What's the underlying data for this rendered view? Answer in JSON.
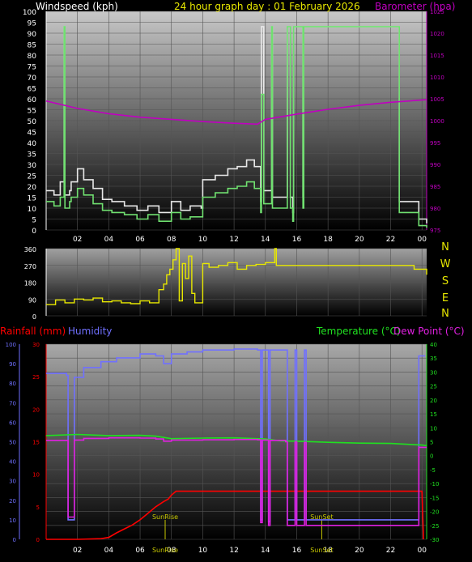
{
  "header": {
    "title": "24 hour graph day : 01 February 2026",
    "left_label": "Windspeed (kph)",
    "right_label": "Barometer (hpa)"
  },
  "colors": {
    "wind_gust": "#e8e8e8",
    "wind_avg": "#70e070",
    "wind_dir": "#e8e800",
    "barometer": "#c000c0",
    "rainfall": "#ff0000",
    "humidity": "#7070ff",
    "temperature": "#20e020",
    "dewpoint": "#e020e0",
    "sun": "#c8c800",
    "axis_text": "#ffffff",
    "title_yellow": "#e8e800"
  },
  "chart_data": [
    {
      "type": "line",
      "title": "24 hour graph day : 01 February 2026",
      "ylabel": "Windspeed (kph)",
      "y2label": "Barometer (hpa)",
      "xlim": [
        0,
        24.3
      ],
      "x_ticks": [
        "02",
        "04",
        "06",
        "08",
        "10",
        "12",
        "14",
        "16",
        "18",
        "20",
        "22",
        "00"
      ],
      "ylim": [
        0,
        100
      ],
      "y_ticks": [
        0,
        5,
        10,
        15,
        20,
        25,
        30,
        35,
        40,
        45,
        50,
        55,
        60,
        65,
        70,
        75,
        80,
        85,
        90,
        95,
        100
      ],
      "y2lim": [
        975,
        1025
      ],
      "y2_ticks": [
        975,
        980,
        985,
        990,
        995,
        1000,
        1005,
        1010,
        1015,
        1020,
        1025
      ],
      "grid": true,
      "series": [
        {
          "name": "Gust",
          "axis": "left",
          "color": "wind_gust",
          "step": true,
          "x": [
            0,
            0.5,
            0.9,
            1.15,
            1.2,
            1.5,
            1.6,
            2.0,
            2.4,
            3.0,
            3.6,
            4.2,
            5.0,
            5.8,
            6.5,
            7.2,
            8.0,
            8.6,
            9.2,
            9.9,
            10.0,
            10.8,
            11.6,
            12.2,
            12.8,
            13.3,
            13.7,
            13.75,
            13.9,
            14.4,
            14.45,
            15.4,
            15.6,
            15.75,
            15.8,
            16.4,
            16.45,
            22.5,
            22.55,
            23.8,
            24.3
          ],
          "y": [
            18,
            16,
            22,
            93,
            16,
            18,
            22,
            28,
            23,
            19,
            14,
            13,
            11,
            9,
            11,
            8,
            13,
            9,
            11,
            10,
            23,
            25,
            28,
            29,
            32,
            29,
            13,
            93,
            18,
            93,
            15,
            93,
            15,
            8,
            93,
            15,
            93,
            93,
            13,
            5,
            3
          ]
        },
        {
          "name": "Average",
          "axis": "left",
          "color": "wind_avg",
          "step": true,
          "x": [
            0,
            0.5,
            0.9,
            1.15,
            1.2,
            1.5,
            1.6,
            2.0,
            2.4,
            3.0,
            3.6,
            4.2,
            5.0,
            5.8,
            6.5,
            7.2,
            8.0,
            8.6,
            9.2,
            9.9,
            10.0,
            10.8,
            11.6,
            12.2,
            12.8,
            13.3,
            13.7,
            13.75,
            13.9,
            14.4,
            14.45,
            15.4,
            15.6,
            15.75,
            15.8,
            16.4,
            16.45,
            22.5,
            22.55,
            23.8,
            24.3
          ],
          "y": [
            13,
            11,
            15,
            93,
            10,
            13,
            15,
            19,
            16,
            12,
            9,
            8,
            7,
            5,
            7,
            4,
            8,
            5,
            6,
            6,
            15,
            17,
            19,
            20,
            22,
            19,
            8,
            62,
            12,
            93,
            10,
            93,
            10,
            4,
            93,
            10,
            93,
            93,
            8,
            2,
            1
          ]
        },
        {
          "name": "Barometer",
          "axis": "right",
          "color": "barometer",
          "x": [
            0,
            2,
            4,
            6,
            8,
            10,
            12,
            13.5,
            14,
            16,
            18,
            20,
            22,
            24.3
          ],
          "y": [
            1004.5,
            1002.8,
            1001.6,
            1000.8,
            1000.3,
            999.8,
            999.4,
            999.2,
            1000.3,
            1001.5,
            1002.6,
            1003.5,
            1004.2,
            1004.8
          ]
        }
      ]
    },
    {
      "type": "line",
      "ylabel": "Wind direction",
      "xlim": [
        0,
        24.3
      ],
      "ylim": [
        0,
        360
      ],
      "y_ticks": [
        0,
        90,
        180,
        270,
        360
      ],
      "compass": [
        "N",
        "W",
        "S",
        "E",
        "N"
      ],
      "grid": true,
      "series": [
        {
          "name": "Direction",
          "color": "wind_dir",
          "step": true,
          "x": [
            0,
            0.6,
            1.2,
            1.8,
            2.4,
            3.0,
            3.6,
            4.2,
            4.8,
            5.4,
            6.0,
            6.6,
            7.2,
            7.5,
            7.7,
            7.9,
            8.1,
            8.3,
            8.5,
            8.7,
            8.9,
            9.1,
            9.3,
            9.5,
            10.0,
            10.4,
            11.0,
            11.6,
            12.2,
            12.8,
            13.4,
            14.0,
            14.6,
            14.7,
            22.0,
            22.5,
            23.5,
            24.3
          ],
          "y": [
            60,
            85,
            70,
            90,
            85,
            95,
            75,
            80,
            70,
            65,
            80,
            70,
            140,
            170,
            220,
            250,
            300,
            360,
            80,
            280,
            200,
            320,
            120,
            70,
            280,
            260,
            270,
            285,
            250,
            270,
            275,
            285,
            360,
            270,
            270,
            270,
            250,
            220
          ]
        }
      ]
    },
    {
      "type": "line",
      "ylabel": "Rainfall (mm)",
      "ylabel2": "Humidity",
      "y2label": "Temperature (°C)",
      "y3label": "Dew Point (°C)",
      "xlim": [
        0,
        24.3
      ],
      "x_ticks": [
        "02",
        "04",
        "06",
        "08",
        "10",
        "12",
        "14",
        "16",
        "18",
        "20",
        "22",
        "00"
      ],
      "ylim_humidity": [
        0,
        100
      ],
      "humidity_ticks": [
        0,
        10,
        20,
        30,
        40,
        50,
        60,
        70,
        80,
        90,
        100
      ],
      "ylim_rain": [
        0,
        30
      ],
      "rain_ticks": [
        0,
        5,
        10,
        15,
        20,
        25,
        30
      ],
      "ylim_temp": [
        -30,
        40
      ],
      "temp_ticks": [
        40,
        35,
        30,
        25,
        20,
        15,
        10,
        5,
        0,
        -5,
        -10,
        -15,
        -20,
        -25,
        -30
      ],
      "grid": true,
      "annotations": [
        {
          "label": "SunRise",
          "x": 7.6,
          "bottom_label": "SunRise"
        },
        {
          "label": "SunSet",
          "x": 17.6,
          "bottom_label": "SunSet"
        }
      ],
      "series": [
        {
          "name": "Rainfall",
          "axis": "rain",
          "color": "rainfall",
          "x": [
            0,
            2,
            3.5,
            4.0,
            4.5,
            5.0,
            5.5,
            6.0,
            6.5,
            7.0,
            7.5,
            7.8,
            8.0,
            8.3,
            20.0,
            24.0,
            24.1
          ],
          "y": [
            0,
            0,
            0.1,
            0.3,
            1.0,
            1.6,
            2.2,
            3.0,
            4.0,
            5.0,
            5.8,
            6.2,
            6.8,
            7.4,
            7.4,
            7.4,
            0
          ]
        },
        {
          "name": "Humidity",
          "axis": "humidity",
          "color": "humidity",
          "step": true,
          "x": [
            0,
            1.3,
            1.4,
            1.8,
            2.4,
            3.5,
            4.5,
            6.0,
            7.0,
            7.5,
            8.0,
            9.0,
            10.0,
            12.0,
            13.5,
            13.7,
            13.8,
            14.2,
            14.3,
            15.3,
            15.4,
            15.9,
            16.0,
            16.5,
            16.6,
            23.7,
            23.8,
            24.2
          ],
          "y": [
            85,
            84,
            10,
            83,
            88,
            91,
            93,
            95,
            94,
            90,
            95,
            96,
            97,
            97.5,
            97,
            10,
            97,
            9,
            97,
            97,
            10,
            97,
            10,
            97,
            10,
            10,
            94,
            94
          ]
        },
        {
          "name": "Temperature",
          "axis": "temp",
          "color": "temperature",
          "x": [
            0,
            2,
            4,
            6,
            7,
            8,
            10,
            12,
            14,
            15,
            16,
            18,
            20,
            22,
            24,
            24.3
          ],
          "y": [
            7.2,
            7.6,
            7.2,
            7.3,
            7.0,
            6.1,
            6.3,
            6.4,
            6.0,
            5.3,
            5.2,
            4.8,
            4.5,
            4.4,
            3.8,
            3.6
          ]
        },
        {
          "name": "Dew Point",
          "axis": "temp",
          "color": "dewpoint",
          "step": true,
          "x": [
            0,
            1.3,
            1.4,
            1.8,
            2.4,
            4.0,
            6.0,
            7.0,
            7.5,
            8.0,
            10.0,
            12.0,
            13.5,
            13.7,
            13.8,
            14.2,
            14.3,
            15.3,
            15.4,
            15.9,
            16.0,
            16.5,
            16.6,
            23.7,
            23.8,
            24.3
          ],
          "y": [
            5.5,
            5.5,
            -22,
            5.6,
            6.2,
            6.4,
            6.3,
            6.0,
            5.2,
            5.6,
            5.7,
            5.8,
            5.7,
            -24,
            5.6,
            -25,
            5.5,
            5.0,
            -25,
            5.0,
            -25,
            4.8,
            -25,
            -25,
            3.0,
            3.0
          ]
        }
      ]
    }
  ],
  "bottom": {
    "rain_label": "Rainfall (mm)",
    "hum_label": "Humidity",
    "temp_label": "Temperature (°C)",
    "dew_label": "Dew Point (°C)"
  }
}
